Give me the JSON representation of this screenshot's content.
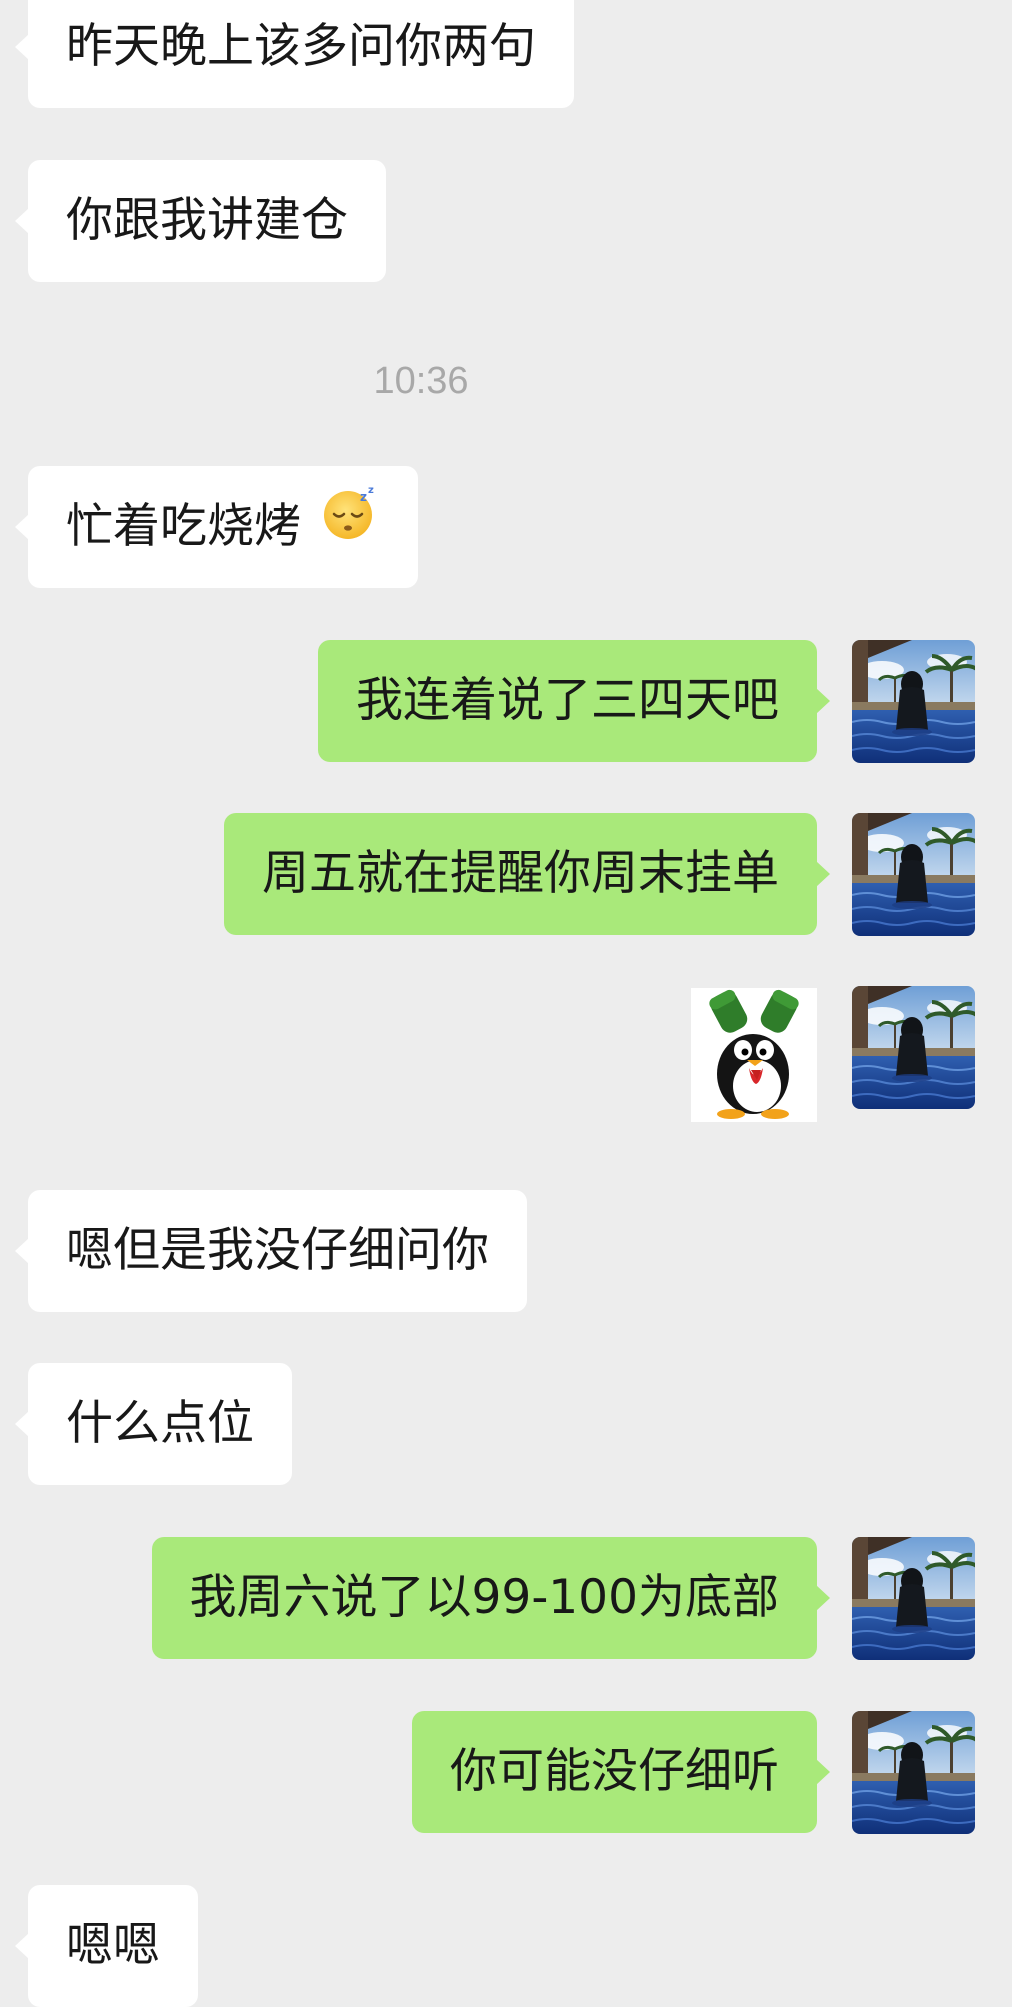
{
  "messages": [
    {
      "side": "left",
      "text": "昨天晚上该多问你两句"
    },
    {
      "side": "left",
      "text": "你跟我讲建仓"
    },
    {
      "side": "left",
      "text": "忙着吃烧烤"
    },
    {
      "side": "right",
      "text": "我连着说了三四天吧"
    },
    {
      "side": "right",
      "text": "周五就在提醒你周末挂单"
    },
    {
      "side": "left",
      "text": "嗯但是我没仔细问你"
    },
    {
      "side": "left",
      "text": "什么点位"
    },
    {
      "side": "right",
      "text": "我周六说了以99-100为底部"
    },
    {
      "side": "right",
      "text": "你可能没仔细听"
    },
    {
      "side": "left",
      "text": "嗯嗯"
    }
  ],
  "timestamp": "10:36",
  "emoji": "sleeping-face",
  "sticker": "penguin-sticker",
  "colors": {
    "background": "#ededed",
    "incoming_bubble": "#ffffff",
    "outgoing_bubble": "#a9e97a",
    "timestamp_text": "#a8a8a8"
  }
}
